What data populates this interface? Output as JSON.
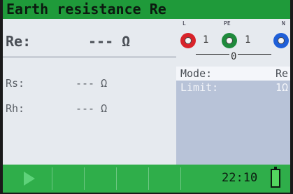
{
  "title": "Earth resistance Re",
  "main": {
    "re_label": "Re:",
    "re_value": "--- Ω",
    "rows": [
      {
        "label": "Rs:",
        "value": "--- Ω"
      },
      {
        "label": "Rh:",
        "value": "--- Ω"
      }
    ]
  },
  "terminals": {
    "l_label": "L",
    "pe_label": "PE",
    "n_label": "N",
    "value_l_pe": "1",
    "value_pe_n": "1",
    "value_l_n": "0",
    "colors": {
      "l": "#d8232a",
      "pe": "#1f8a3c",
      "n": "#1f5fd8"
    }
  },
  "settings": {
    "mode_label": "Mode:",
    "mode_value": "Re",
    "limit_label": "Limit:",
    "limit_value": "1Ω"
  },
  "status": {
    "time": "22:10",
    "play_icon": "play-icon",
    "battery_icon": "battery-icon"
  }
}
